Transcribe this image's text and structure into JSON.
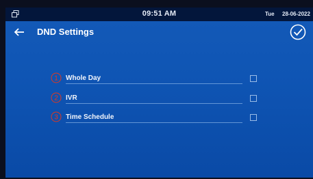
{
  "status_bar": {
    "time": "09:51 AM",
    "day": "Tue",
    "date": "28-06-2022",
    "icon": "window-restore-icon"
  },
  "header": {
    "title": "DND Settings",
    "back_icon": "arrow-left-icon",
    "confirm_icon": "check-circle-icon"
  },
  "options": [
    {
      "number": "1",
      "label": "Whole Day",
      "checked": false
    },
    {
      "number": "2",
      "label": "IVR",
      "checked": false
    },
    {
      "number": "3",
      "label": "Time Schedule",
      "checked": false
    }
  ],
  "colors": {
    "background": "#0f55b4",
    "status_bar": "#03163b",
    "number_accent": "#e2381e"
  }
}
